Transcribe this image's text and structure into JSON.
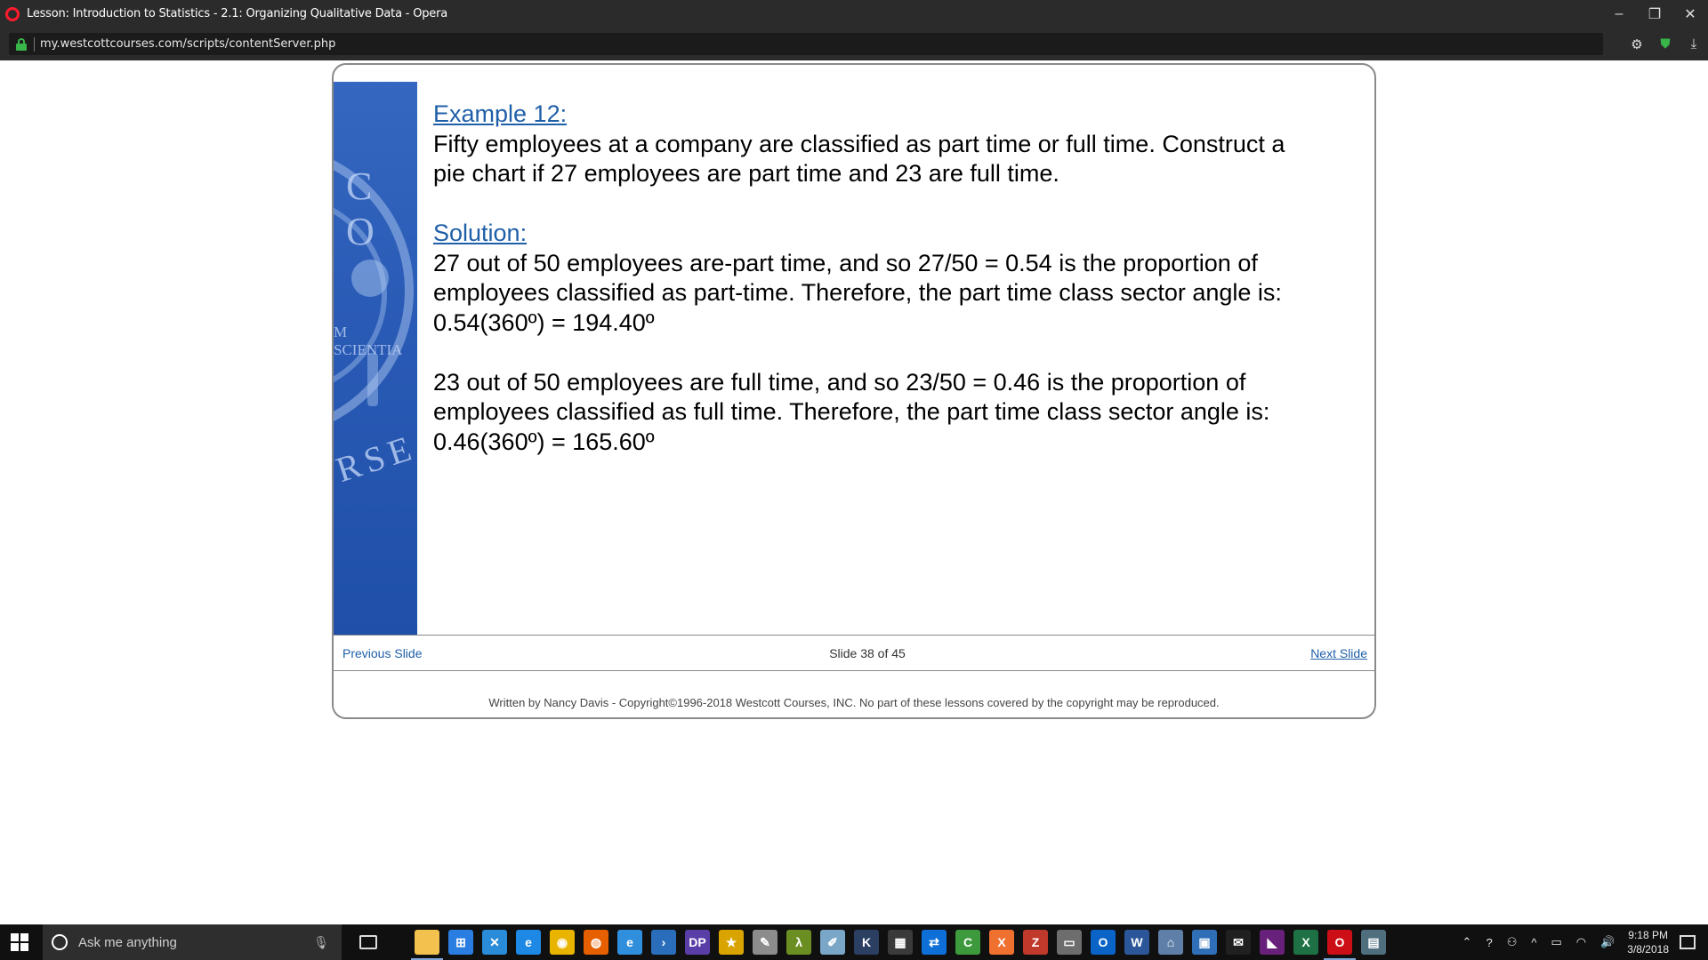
{
  "window": {
    "title": "Lesson: Introduction to Statistics - 2.1: Organizing Qualitative Data - Opera",
    "controls": [
      "minimize",
      "restore",
      "close"
    ]
  },
  "address_bar": {
    "url": "my.westcottcourses.com/scripts/contentServer.php",
    "icons": [
      "settings-icon",
      "shield-icon",
      "download-icon"
    ]
  },
  "slide": {
    "example_heading": "Example 12:",
    "example_lines": [
      "Fifty employees at a company are classified as part time or full time.  Construct a",
      "pie chart if 27 employees are part time and 23 are full time."
    ],
    "solution_heading": "Solution:",
    "solution_para1": [
      "27 out of 50 employees are-part time, and so 27/50 = 0.54 is the proportion of",
      "employees classified as part-time.  Therefore, the part time class sector angle is:",
      "0.54(360º) = 194.40º"
    ],
    "solution_para2": [
      "23 out of 50 employees are full time, and so 23/50 = 0.46 is the proportion of",
      "employees classified as full time.  Therefore, the part time class sector angle is:",
      "0.46(360º) = 165.60º"
    ],
    "banner_text": {
      "co": "C O",
      "scientia": "M SCIENTIA",
      "rse": "RSE"
    }
  },
  "nav": {
    "previous": "Previous Slide",
    "counter": "Slide 38 of 45",
    "next": "Next Slide"
  },
  "footer": {
    "copyright": "Written by Nancy Davis - Copyright©1996-2018 Westcott Courses, INC. No part of these lessons covered by the copyright may be reproduced."
  },
  "taskbar": {
    "search_placeholder": "Ask me anything",
    "apps": [
      {
        "name": "file-explorer",
        "color": "#f2c14e",
        "glyph": ""
      },
      {
        "name": "store",
        "color": "#2a7de1",
        "glyph": "⊞"
      },
      {
        "name": "visual-studio-tool",
        "color": "#2a8bd8",
        "glyph": "✕"
      },
      {
        "name": "edge",
        "color": "#1e88e5",
        "glyph": "e"
      },
      {
        "name": "chrome",
        "color": "#e8b400",
        "glyph": "◉"
      },
      {
        "name": "firefox",
        "color": "#e66000",
        "glyph": "◍"
      },
      {
        "name": "internet-explorer",
        "color": "#2f8fdd",
        "glyph": "e"
      },
      {
        "name": "powershell",
        "color": "#2a6ebb",
        "glyph": "›"
      },
      {
        "name": "dp-app",
        "color": "#5a3ea8",
        "glyph": "DP"
      },
      {
        "name": "star-app",
        "color": "#d9a400",
        "glyph": "★"
      },
      {
        "name": "paint-app",
        "color": "#8c8c8c",
        "glyph": "✎"
      },
      {
        "name": "lambda-app",
        "color": "#6b8e23",
        "glyph": "λ"
      },
      {
        "name": "notes-app",
        "color": "#7aa7c7",
        "glyph": "✐"
      },
      {
        "name": "kindle-app",
        "color": "#2b3f63",
        "glyph": "K"
      },
      {
        "name": "calculator",
        "color": "#3a3a3a",
        "glyph": "▦"
      },
      {
        "name": "teamviewer",
        "color": "#0e6fd8",
        "glyph": "⇄"
      },
      {
        "name": "camtasia",
        "color": "#3c9a3c",
        "glyph": "C"
      },
      {
        "name": "xampp",
        "color": "#f07030",
        "glyph": "X"
      },
      {
        "name": "filezilla",
        "color": "#c0392b",
        "glyph": "Z"
      },
      {
        "name": "screen-app",
        "color": "#6d6d6d",
        "glyph": "▭"
      },
      {
        "name": "outlook",
        "color": "#0a64c8",
        "glyph": "O"
      },
      {
        "name": "word",
        "color": "#2b579a",
        "glyph": "W"
      },
      {
        "name": "network-app",
        "color": "#5f7fa8",
        "glyph": "⌂"
      },
      {
        "name": "remote-desktop",
        "color": "#2f6fb8",
        "glyph": "▣"
      },
      {
        "name": "mail",
        "color": "#202020",
        "glyph": "✉"
      },
      {
        "name": "visual-studio",
        "color": "#68217a",
        "glyph": "◣"
      },
      {
        "name": "excel",
        "color": "#1e7145",
        "glyph": "X"
      },
      {
        "name": "opera",
        "color": "#cc0f16",
        "glyph": "O"
      },
      {
        "name": "sticky-app",
        "color": "#4f6f7f",
        "glyph": "▤"
      }
    ],
    "clock_time": "9:18 PM",
    "clock_date": "3/8/2018"
  }
}
